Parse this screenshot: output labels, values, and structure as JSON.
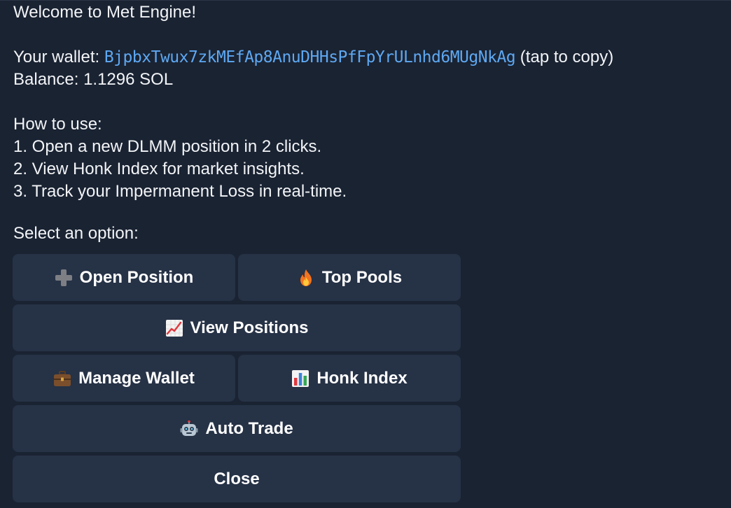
{
  "message": {
    "welcome": "Welcome to Met Engine!",
    "wallet_label": "Your wallet: ",
    "wallet_address": "BjpbxTwux7zkMEfAp8AnuDHHsPfFpYrULnhd6MUgNkAg",
    "wallet_hint": " (tap to copy)",
    "balance": "Balance: 1.1296 SOL",
    "howto_title": "How to use:",
    "step1": "1. Open a new DLMM position in 2 clicks.",
    "step2": "2. View Honk Index for market insights.",
    "step3": "3. Track your Impermanent Loss in real-time.",
    "select_prompt": "Select an option:"
  },
  "keyboard": {
    "open_position": "Open Position",
    "top_pools": "Top Pools",
    "view_positions": "View Positions",
    "manage_wallet": "Manage Wallet",
    "honk_index": "Honk Index",
    "auto_trade": "Auto Trade",
    "close": "Close"
  },
  "icons": {
    "open_position": "plus-icon",
    "top_pools": "fire-icon",
    "view_positions": "chart-increasing-icon",
    "manage_wallet": "briefcase-icon",
    "honk_index": "bar-chart-icon",
    "auto_trade": "robot-icon"
  },
  "colors": {
    "background": "#1a2332",
    "button": "#263246",
    "link": "#5ea8f2",
    "text": "#f2f4f7"
  }
}
